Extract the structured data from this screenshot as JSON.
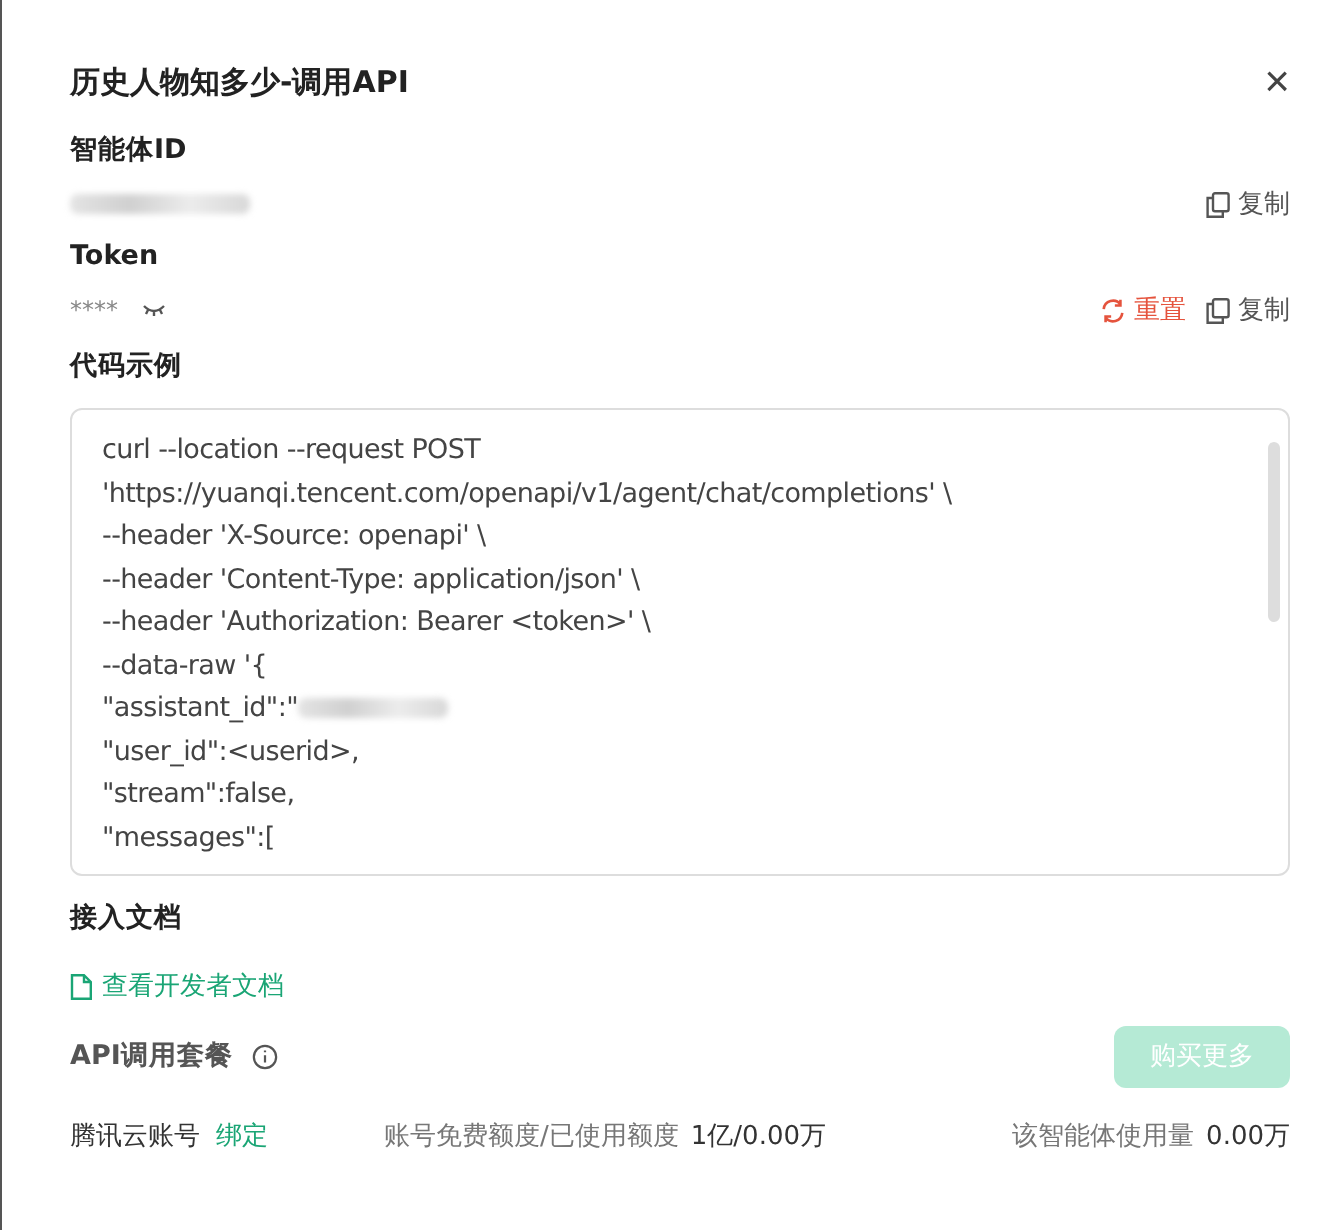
{
  "dialog": {
    "title": "历史人物知多少-调用API",
    "close": "×"
  },
  "agent_id": {
    "label": "智能体ID",
    "copy": "复制"
  },
  "token": {
    "label": "Token",
    "value": "****",
    "reset": "重置",
    "copy": "复制"
  },
  "code_example": {
    "label": "代码示例",
    "lines": [
      {
        "text": "curl --location --request POST",
        "redacted": false
      },
      {
        "text": "'https://yuanqi.tencent.com/openapi/v1/agent/chat/completions' \\",
        "redacted": false
      },
      {
        "text": "--header 'X-Source: openapi' \\",
        "redacted": false
      },
      {
        "text": "--header 'Content-Type: application/json' \\",
        "redacted": false
      },
      {
        "text": "--header 'Authorization: Bearer <token>' \\",
        "redacted": false
      },
      {
        "text": "--data-raw '{",
        "redacted": false
      },
      {
        "text": "\"assistant_id\":\"",
        "redacted": true
      },
      {
        "text": "\"user_id\":<userid>,",
        "redacted": false
      },
      {
        "text": "\"stream\":false,",
        "redacted": false
      },
      {
        "text": "\"messages\":[",
        "redacted": false
      }
    ]
  },
  "docs": {
    "label": "接入文档",
    "link": "查看开发者文档"
  },
  "plan": {
    "label": "API调用套餐",
    "button": {
      "label": "购买更多",
      "disabled": true
    },
    "account_label": "腾讯云账号",
    "bind": "绑定",
    "quota_label": "账号免费额度/已使用额度",
    "quota_value": "1亿/0.00万",
    "usage_label": "该智能体使用量",
    "usage_value": "0.00万"
  }
}
